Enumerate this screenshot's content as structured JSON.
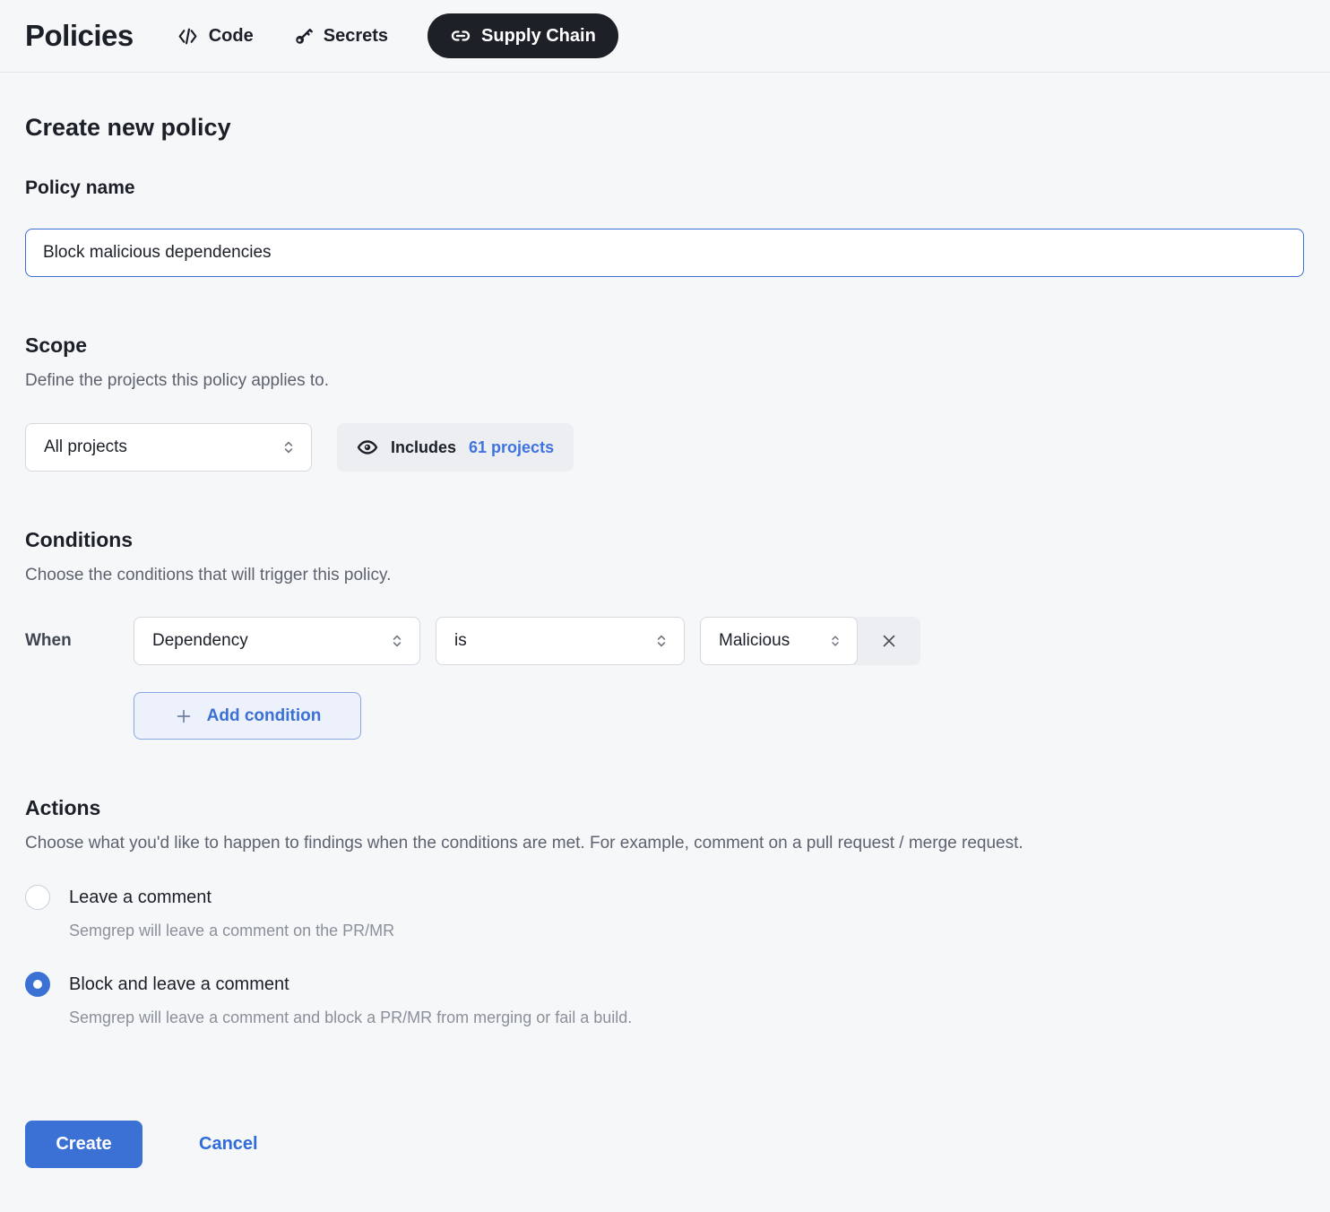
{
  "header": {
    "title": "Policies",
    "tabs": [
      {
        "label": "Code",
        "icon": "code-icon",
        "active": false
      },
      {
        "label": "Secrets",
        "icon": "key-icon",
        "active": false
      },
      {
        "label": "Supply Chain",
        "icon": "link-icon",
        "active": true
      }
    ]
  },
  "form": {
    "title": "Create new policy",
    "policy_name": {
      "label": "Policy name",
      "value": "Block malicious dependencies"
    },
    "scope": {
      "label": "Scope",
      "description": "Define the projects this policy applies to.",
      "selected_option": "All projects",
      "includes_label": "Includes",
      "includes_count": "61 projects"
    },
    "conditions": {
      "label": "Conditions",
      "description": "Choose the conditions that will trigger this policy.",
      "when_label": "When",
      "condition": {
        "field": "Dependency",
        "operator": "is",
        "value": "Malicious"
      },
      "add_button_label": "Add condition"
    },
    "actions": {
      "label": "Actions",
      "description": "Choose what you'd like to happen to findings when the conditions are met. For example, comment on a pull request / merge request.",
      "options": [
        {
          "label": "Leave a comment",
          "description": "Semgrep will leave a comment on the PR/MR",
          "selected": false
        },
        {
          "label": "Block and leave a comment",
          "description": "Semgrep will leave a comment and block a PR/MR from merging or fail a build.",
          "selected": true
        }
      ]
    },
    "footer": {
      "create_label": "Create",
      "cancel_label": "Cancel"
    }
  },
  "icons": {
    "code-icon": "</>",
    "key-icon": "key glyph",
    "link-icon": "chain link",
    "eye-icon": "filled eye",
    "chevron-up-down-icon": "⌃⌄",
    "plus-icon": "+",
    "close-icon": "×"
  },
  "colors": {
    "page_bg": "#f6f7f9",
    "accent_blue": "#3b70d4",
    "link_blue": "#3e73e0",
    "active_tab_bg": "#1d2127",
    "badge_bg": "#eceef1",
    "border_gray": "#d5d8dd",
    "desc_gray": "#5c626e"
  }
}
